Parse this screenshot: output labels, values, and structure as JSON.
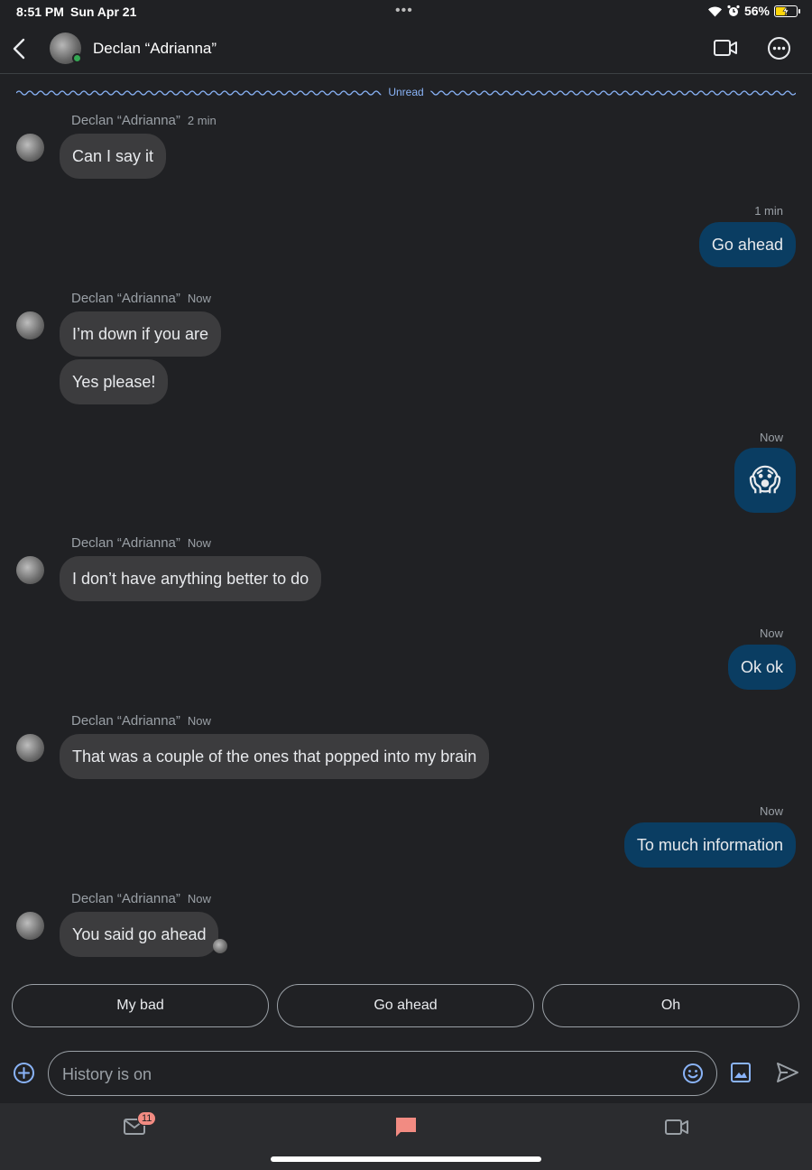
{
  "status_bar": {
    "time": "8:51 PM",
    "date": "Sun Apr 21",
    "dots": "•••",
    "battery_pct": "56%",
    "battery_level": 0.56,
    "icons": [
      "wifi-icon",
      "alarm-icon",
      "battery-charging-icon"
    ]
  },
  "header": {
    "contact_name": "Declan “Adrianna”",
    "online": true,
    "icons": [
      "back-chevron-icon",
      "video-call-icon",
      "more-options-icon"
    ]
  },
  "unread_label": "Unread",
  "messages": [
    {
      "sender": "Declan “Adrianna”",
      "time": "2 min",
      "text": "Can I say it"
    },
    {
      "time": "1 min",
      "text": "Go ahead"
    },
    {
      "sender": "Declan “Adrianna”",
      "time": "Now",
      "text": "I’m down if you are"
    },
    {
      "text": "Yes please!"
    },
    {
      "time": "Now",
      "text": "😱"
    },
    {
      "sender": "Declan “Adrianna”",
      "time": "Now",
      "text": "I don’t have anything better to do"
    },
    {
      "time": "Now",
      "text": "Ok ok"
    },
    {
      "sender": "Declan “Adrianna”",
      "time": "Now",
      "text": "That was a couple of the ones that popped into my brain"
    },
    {
      "time": "Now",
      "text": "To much information"
    },
    {
      "sender": "Declan “Adrianna”",
      "time": "Now",
      "text": "You said go ahead"
    }
  ],
  "smart_replies": [
    "My bad",
    "Go ahead",
    "Oh"
  ],
  "compose": {
    "placeholder": "History is on",
    "icons": [
      "add-icon",
      "emoji-icon",
      "image-icon",
      "send-icon"
    ]
  },
  "bottom_nav": {
    "mail_badge": "11",
    "items": [
      "mail-icon",
      "chat-icon",
      "meet-icon"
    ]
  },
  "colors": {
    "background": "#202124",
    "incoming_bubble": "#3c3c3e",
    "outgoing_bubble": "#0a3d62",
    "accent": "#8ab4f8",
    "badge": "#f28b82",
    "online": "#34a853",
    "chat_active": "#f28b82"
  }
}
